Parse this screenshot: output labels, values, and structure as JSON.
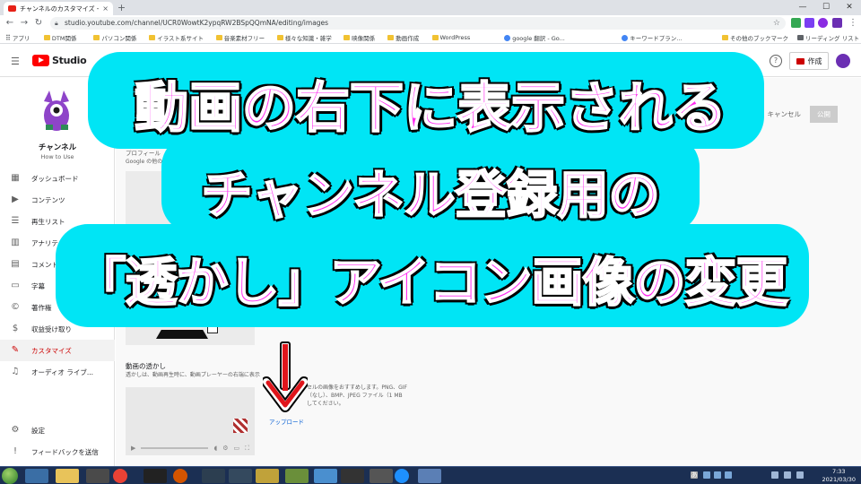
{
  "browser": {
    "tab_title": "チャンネルのカスタマイズ - YouTube Studio",
    "tab_close": "×",
    "new_tab": "+",
    "url": "studio.youtube.com/channel/UCR0WowtK2ypqRW2BSpQQmNA/editing/images",
    "window": {
      "minimize": "—",
      "maximize": "☐",
      "close": "✕"
    },
    "nav": {
      "back": "←",
      "forward": "→",
      "reload": "↻"
    },
    "bookmarks": [
      {
        "label": "アプリ",
        "kind": "apps"
      },
      {
        "label": "DTM関係",
        "kind": "folder"
      },
      {
        "label": "パソコン関係",
        "kind": "folder"
      },
      {
        "label": "イラスト系サイト",
        "kind": "folder"
      },
      {
        "label": "音楽素材フリー",
        "kind": "folder"
      },
      {
        "label": "様々な知識・雑学",
        "kind": "folder"
      },
      {
        "label": "映像関係",
        "kind": "folder"
      },
      {
        "label": "動画作成",
        "kind": "folder"
      },
      {
        "label": "WordPress",
        "kind": "folder"
      },
      {
        "label": "google 翻訳 - Go...",
        "kind": "google"
      },
      {
        "label": "キーワードプラン...",
        "kind": "google"
      }
    ],
    "bookmarks_right": [
      {
        "label": "その他のブックマーク",
        "kind": "folder"
      },
      {
        "label": "リーディング リスト",
        "kind": "list"
      }
    ]
  },
  "studio": {
    "logo_text": "Studio",
    "help": "?",
    "create_label": "作成",
    "channel_name": "チャンネル",
    "channel_sub": "How to Use",
    "nav_items": [
      {
        "label": "ダッシュボード",
        "icon": "dashboard-icon",
        "glyph": "▦"
      },
      {
        "label": "コンテンツ",
        "icon": "content-icon",
        "glyph": "▶"
      },
      {
        "label": "再生リスト",
        "icon": "playlist-icon",
        "glyph": "☰"
      },
      {
        "label": "アナリティクス",
        "icon": "analytics-icon",
        "glyph": "▥"
      },
      {
        "label": "コメント",
        "icon": "comments-icon",
        "glyph": "▤"
      },
      {
        "label": "字幕",
        "icon": "subtitles-icon",
        "glyph": "▭"
      },
      {
        "label": "著作権",
        "icon": "copyright-icon",
        "glyph": "©"
      },
      {
        "label": "収益受け取り",
        "icon": "monetization-icon",
        "glyph": "$"
      },
      {
        "label": "カスタマイズ",
        "icon": "customize-icon",
        "glyph": "✎"
      },
      {
        "label": "オーディオ ライブ...",
        "icon": "audio-library-icon",
        "glyph": "♫"
      }
    ],
    "nav_bottom": [
      {
        "label": "設定",
        "icon": "settings-icon",
        "glyph": "⚙"
      },
      {
        "label": "フィードバックを送信",
        "icon": "feedback-icon",
        "glyph": "!"
      }
    ],
    "actions": {
      "preview": "示",
      "cancel": "キャンセル",
      "publish": "公開"
    },
    "profile_section": {
      "title": "プロフィール",
      "text": "Google の他の"
    },
    "watermark_section": {
      "title": "動画の透かし",
      "desc": "透かしは、動画再生時に、動画プレーヤーの右端に表示",
      "hint": "セルの画像をおすすめします。PNG、GIF\n（なし）、BMP、JPEG ファイル（1 MB\nしてください。",
      "upload": "アップロード"
    }
  },
  "overlay": {
    "lines": [
      "動画の右下に表示される",
      "チャンネル登録用の",
      "「透かし」アイコン画像の変更"
    ],
    "colors": {
      "text": "#ff2bf0",
      "outline": "#ffffff",
      "shadow": "#000000",
      "backdrop": "#00e5f5"
    }
  },
  "arrow": {
    "color": "#e0151b"
  },
  "taskbar": {
    "time": "7:33",
    "date": "2021/03/30",
    "ime": "あ"
  }
}
